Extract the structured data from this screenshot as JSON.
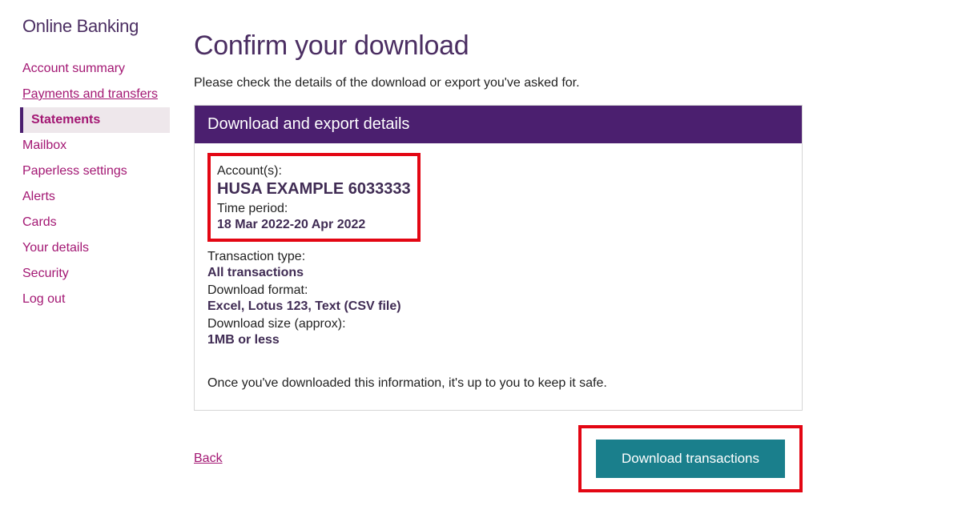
{
  "sidebar": {
    "title": "Online Banking",
    "items": [
      {
        "label": "Account summary",
        "active": false
      },
      {
        "label": "Payments and transfers",
        "active": false
      },
      {
        "label": "Statements",
        "active": true
      },
      {
        "label": "Mailbox",
        "active": false
      },
      {
        "label": "Paperless settings",
        "active": false
      },
      {
        "label": "Alerts",
        "active": false
      },
      {
        "label": "Cards",
        "active": false
      },
      {
        "label": "Your details",
        "active": false
      },
      {
        "label": "Security",
        "active": false
      },
      {
        "label": "Log out",
        "active": false
      }
    ]
  },
  "page": {
    "title": "Confirm your download",
    "intro": "Please check the details of the download or export you've asked for."
  },
  "panel": {
    "header": "Download and export details",
    "accounts_label": "Account(s):",
    "accounts_value": "HUSA EXAMPLE 6033333",
    "period_label": "Time period:",
    "period_value": "18 Mar 2022-20 Apr 2022",
    "txtype_label": "Transaction type:",
    "txtype_value": "All transactions",
    "format_label": "Download format:",
    "format_value": "Excel, Lotus 123, Text (CSV file)",
    "size_label": "Download size (approx):",
    "size_value": "1MB or less",
    "safety_note": "Once you've downloaded this information, it's up to you to keep it safe."
  },
  "actions": {
    "back": "Back",
    "download": "Download transactions"
  }
}
